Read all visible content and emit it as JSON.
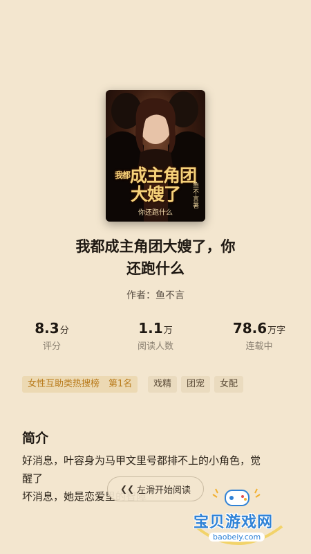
{
  "book": {
    "title_line1": "我都成主角团大嫂了，你",
    "title_line2": "还跑什么",
    "author": "作者：鱼不言",
    "cover": {
      "title": "成主角团大嫂了",
      "prefix": "我都",
      "subtitle": "你还跑什么",
      "author": "鱼不言著"
    }
  },
  "stats": [
    {
      "value": "8.3",
      "unit": "分",
      "label": "评分"
    },
    {
      "value": "1.1",
      "unit": "万",
      "label": "阅读人数"
    },
    {
      "value": "78.6",
      "unit": "万字",
      "label": "连载中"
    }
  ],
  "tags": [
    "女性互助类热搜榜　第1名",
    "戏精",
    "团宠",
    "女配"
  ],
  "intro": {
    "heading": "简介",
    "lines": [
      "好消息，叶容身为马甲文里号都排不上的小角色，觉",
      "醒了",
      "坏消息，她是恋爱里的智障"
    ]
  },
  "swipe": {
    "label": "左滑开始阅读",
    "icon": "double-chevron-left-icon"
  },
  "watermark": {
    "text": "宝贝游戏网",
    "url": "baobeiy.com"
  }
}
